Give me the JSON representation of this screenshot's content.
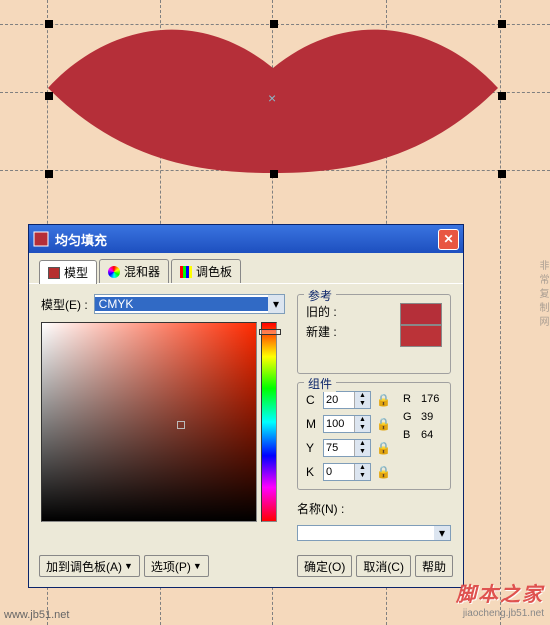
{
  "dialog": {
    "title": "均匀填充",
    "tabs": {
      "model": "模型",
      "mixer": "混和器",
      "palette": "调色板"
    },
    "model_label": "模型(E) :",
    "model_value": "CMYK",
    "ref": {
      "title": "参考",
      "old": "旧的 :",
      "new": "新建 :"
    },
    "comp": {
      "title": "组件",
      "c_label": "C",
      "c": "20",
      "m_label": "M",
      "m": "100",
      "y_label": "Y",
      "y": "75",
      "k_label": "K",
      "k": "0",
      "r_label": "R",
      "r": "176",
      "g_label": "G",
      "g": "39",
      "b_label": "B",
      "b": "64"
    },
    "name_label": "名称(N) :",
    "name_value": "",
    "buttons": {
      "add_palette": "加到调色板(A)",
      "options": "选项(P)",
      "ok": "确定(O)",
      "cancel": "取消(C)",
      "help": "帮助"
    }
  },
  "colors": {
    "lips": "#b52f39"
  },
  "footer": {
    "url": "www.jb51.net",
    "wm": "脚本之家",
    "wm_sub": "jiaocheng.jb51.net"
  },
  "side": "非常复制网"
}
